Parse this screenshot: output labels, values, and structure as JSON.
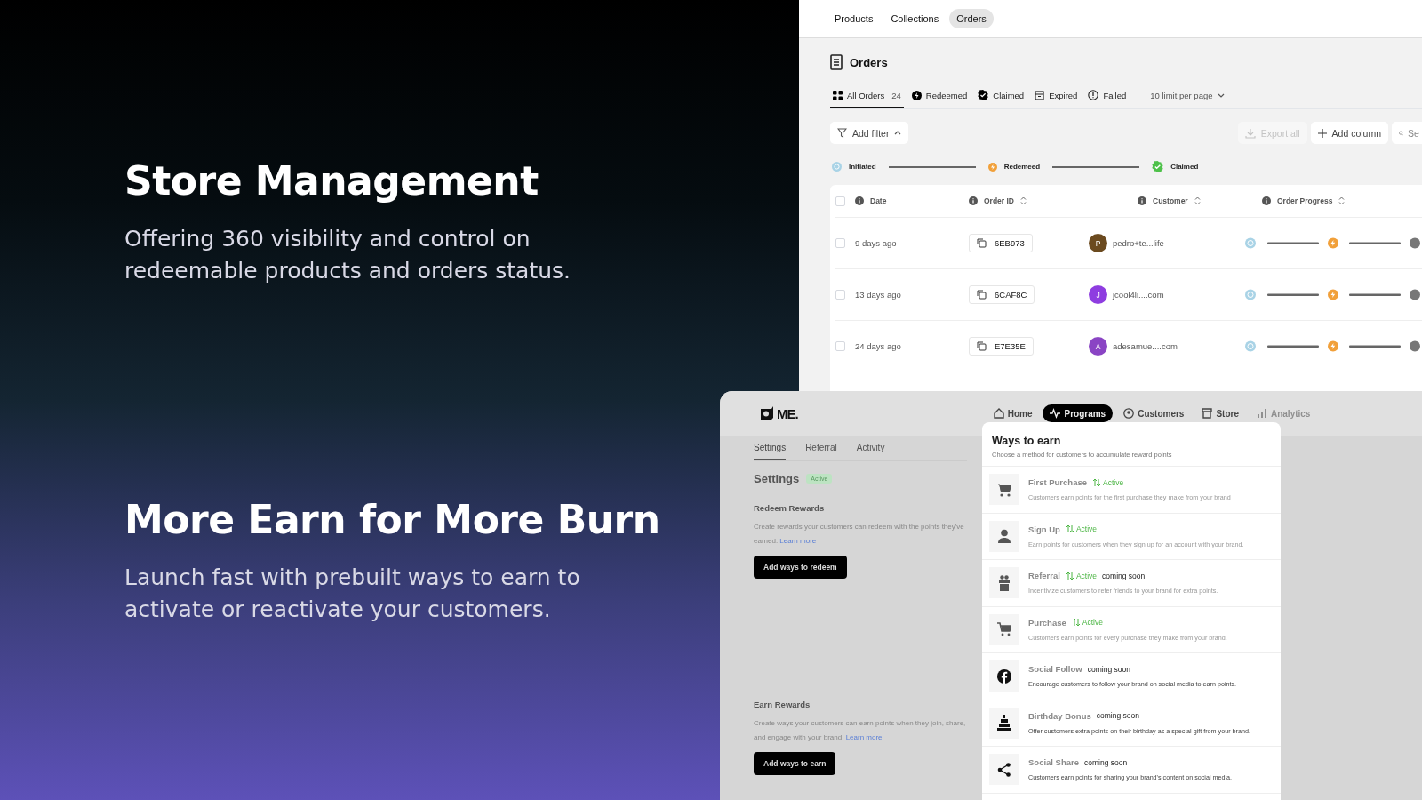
{
  "intro": [
    {
      "title": "Store Management",
      "body": "Offering 360 visibility and control on redeemable products and orders status."
    },
    {
      "title": "More Earn for More Burn",
      "body": "Launch fast with prebuilt ways to earn to activate or reactivate your customers."
    }
  ],
  "orders_window": {
    "nav": [
      {
        "label": "Products",
        "selected": false
      },
      {
        "label": "Collections",
        "selected": false
      },
      {
        "label": "Orders",
        "selected": true
      }
    ],
    "title": "Orders",
    "filters": [
      {
        "kind": "all",
        "label": "All Orders",
        "count": "24",
        "selected": true
      },
      {
        "kind": "redeemed",
        "label": "Redeemed",
        "selected": false
      },
      {
        "kind": "claimed",
        "label": "Claimed",
        "selected": false
      },
      {
        "kind": "expired",
        "label": "Expired",
        "selected": false
      },
      {
        "kind": "failed",
        "label": "Failed",
        "selected": false
      }
    ],
    "page_size": "10 limit per page",
    "add_filter": "Add filter",
    "export": {
      "label": "Export all",
      "disabled": true
    },
    "add_column": "Add column",
    "search": {
      "placeholder": "Se"
    },
    "legend": [
      {
        "kind": "initiated",
        "label": "Initiated"
      },
      {
        "kind": "redeemed",
        "label": "Redemeed"
      },
      {
        "kind": "claimed",
        "label": "Claimed"
      }
    ],
    "columns": [
      "Date",
      "Order ID",
      "Customer",
      "Order Progress"
    ],
    "select_all_checked": false,
    "rows": [
      {
        "checked": false,
        "date": "9 days ago",
        "order_id": "6EB973",
        "initial": "P",
        "color": "#6b4a1f",
        "customer": "pedro+te...life"
      },
      {
        "checked": false,
        "date": "13 days ago",
        "order_id": "6CAF8C",
        "initial": "J",
        "color": "#8e3de0",
        "customer": "jcool4li....com"
      },
      {
        "checked": false,
        "date": "24 days ago",
        "order_id": "E7E35E",
        "initial": "A",
        "color": "#8a44c4",
        "customer": "adesamue....com"
      }
    ]
  },
  "programs_window": {
    "logo": "ME.",
    "nav": [
      {
        "kind": "home",
        "label": "Home",
        "selected": false,
        "disabled": false
      },
      {
        "kind": "programs",
        "label": "Programs",
        "selected": true,
        "disabled": false
      },
      {
        "kind": "customers",
        "label": "Customers",
        "selected": false,
        "disabled": false
      },
      {
        "kind": "store",
        "label": "Store",
        "selected": false,
        "disabled": false
      },
      {
        "kind": "analytics",
        "label": "Analytics",
        "selected": false,
        "disabled": true
      }
    ],
    "tabs": [
      {
        "label": "Settings",
        "selected": true
      },
      {
        "label": "Referral",
        "selected": false
      },
      {
        "label": "Activity",
        "selected": false
      }
    ],
    "heading": "Settings",
    "status": "Active",
    "sections": [
      {
        "title": "Redeem Rewards",
        "body": "Create rewards your customers can redeem with the points they've earned.",
        "link": "Learn more",
        "button": "Add ways to redeem"
      },
      {
        "title": "Earn Rewards",
        "body": "Create ways your customers can earn points when they join, share, and engage with your brand.",
        "link": "Learn more",
        "button": "Add ways to earn"
      }
    ],
    "modal": {
      "title": "Ways to earn",
      "subtitle": "Choose a method for customers to accumulate reward points",
      "items": [
        {
          "kind": "cart",
          "title": "First Purchase",
          "status": "Active",
          "desc": "Customers earn points for the first purchase they make from your brand"
        },
        {
          "kind": "person",
          "title": "Sign Up",
          "status": "Active",
          "desc": "Earn points for customers when they sign up for an account with your brand."
        },
        {
          "kind": "gift",
          "title": "Referral",
          "status": "Active",
          "note": "coming soon",
          "desc": "Incentivize customers to refer friends to your brand for extra points."
        },
        {
          "kind": "trolley",
          "title": "Purchase",
          "status": "Active",
          "desc": "Customers earn points for every purchase they make from your brand."
        },
        {
          "kind": "facebook",
          "title": "Social Follow",
          "note": "coming soon",
          "desc": "Encourage customers to follow your brand on social media to earn points."
        },
        {
          "kind": "cake",
          "title": "Birthday Bonus",
          "note": "coming soon",
          "desc": "Offer customers extra points on their birthday as a special gift from your brand."
        },
        {
          "kind": "share",
          "title": "Social Share",
          "note": "coming soon",
          "desc": "Customers earn points for sharing your brand's content on social media."
        }
      ]
    }
  }
}
